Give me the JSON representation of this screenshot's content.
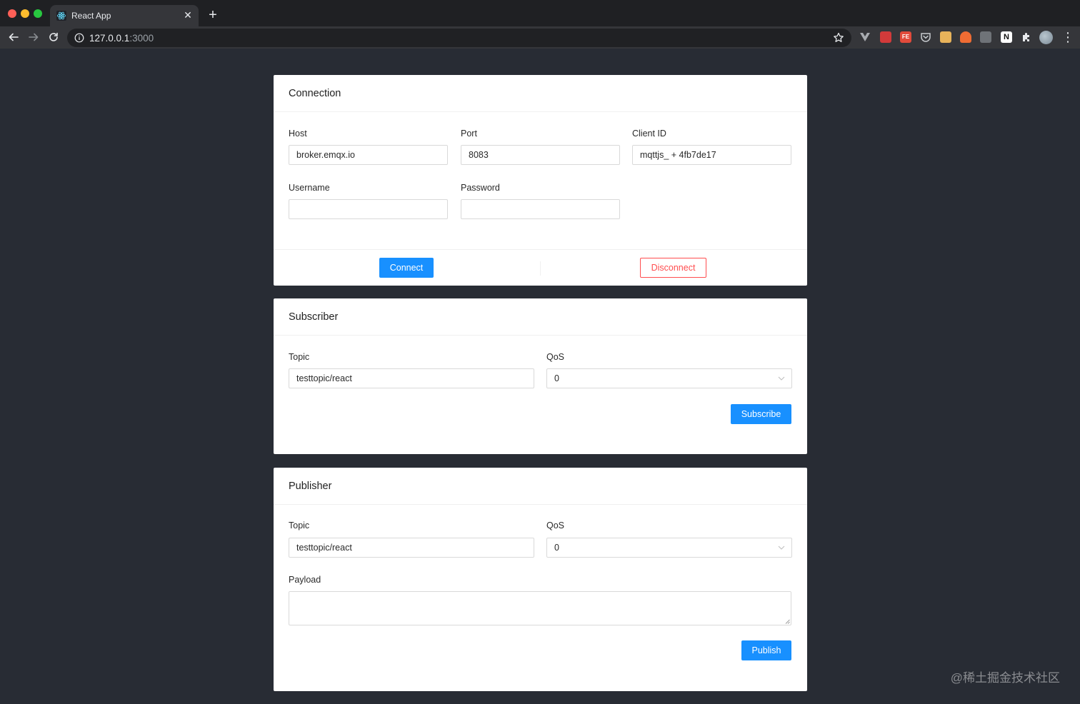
{
  "browser": {
    "tab_title": "React App",
    "url_host": "127.0.0.1",
    "url_port": ":3000"
  },
  "connection": {
    "title": "Connection",
    "host_label": "Host",
    "host_value": "broker.emqx.io",
    "port_label": "Port",
    "port_value": "8083",
    "client_id_label": "Client ID",
    "client_id_value": "mqttjs_ + 4fb7de17",
    "username_label": "Username",
    "username_value": "",
    "password_label": "Password",
    "password_value": "",
    "connect_label": "Connect",
    "disconnect_label": "Disconnect"
  },
  "subscriber": {
    "title": "Subscriber",
    "topic_label": "Topic",
    "topic_value": "testtopic/react",
    "qos_label": "QoS",
    "qos_value": "0",
    "subscribe_label": "Subscribe"
  },
  "publisher": {
    "title": "Publisher",
    "topic_label": "Topic",
    "topic_value": "testtopic/react",
    "qos_label": "QoS",
    "qos_value": "0",
    "payload_label": "Payload",
    "payload_value": "",
    "publish_label": "Publish"
  },
  "watermark": "@稀土掘金技术社区",
  "colors": {
    "primary": "#1890ff",
    "danger": "#ff4d4f",
    "page_bg": "#282c34"
  }
}
